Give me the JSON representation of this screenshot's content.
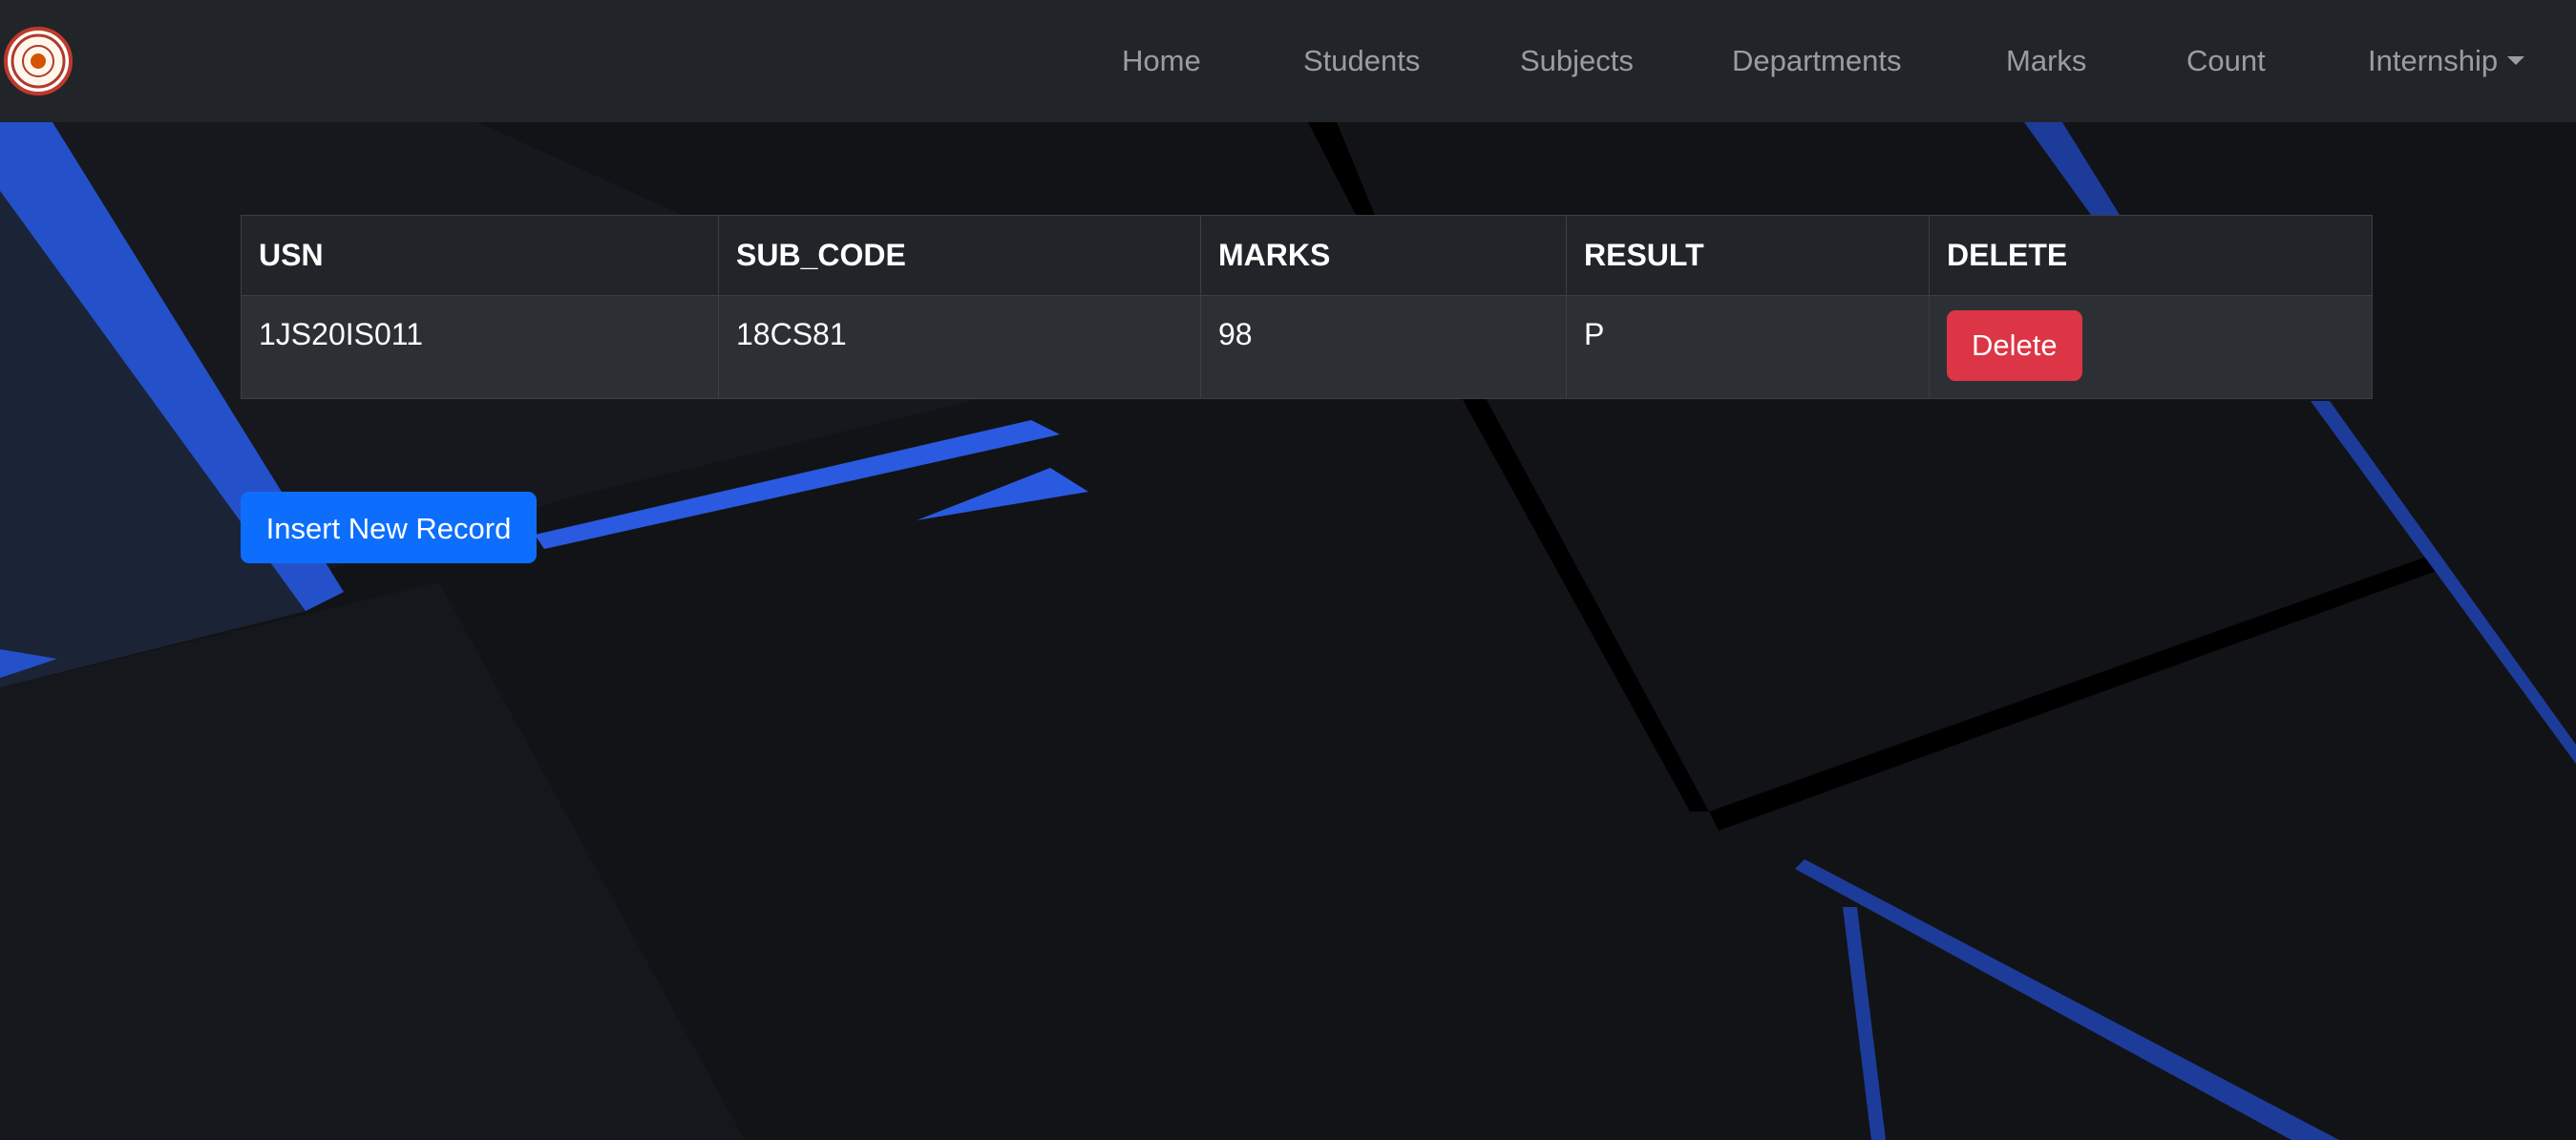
{
  "nav": {
    "items": [
      {
        "label": "Home"
      },
      {
        "label": "Students"
      },
      {
        "label": "Subjects"
      },
      {
        "label": "Departments"
      },
      {
        "label": "Marks"
      },
      {
        "label": "Count"
      },
      {
        "label": "Internship"
      }
    ]
  },
  "table": {
    "headers": [
      "USN",
      "SUB_CODE",
      "MARKS",
      "RESULT",
      "DELETE"
    ],
    "rows": [
      {
        "usn": "1JS20IS011",
        "sub_code": "18CS81",
        "marks": "98",
        "result": "P",
        "action": "Delete"
      }
    ]
  },
  "insert_button_label": "Insert New Record",
  "colors": {
    "navbar": "#212529",
    "primary": "#0d6efd",
    "danger": "#dc3545",
    "background": "#121317"
  }
}
